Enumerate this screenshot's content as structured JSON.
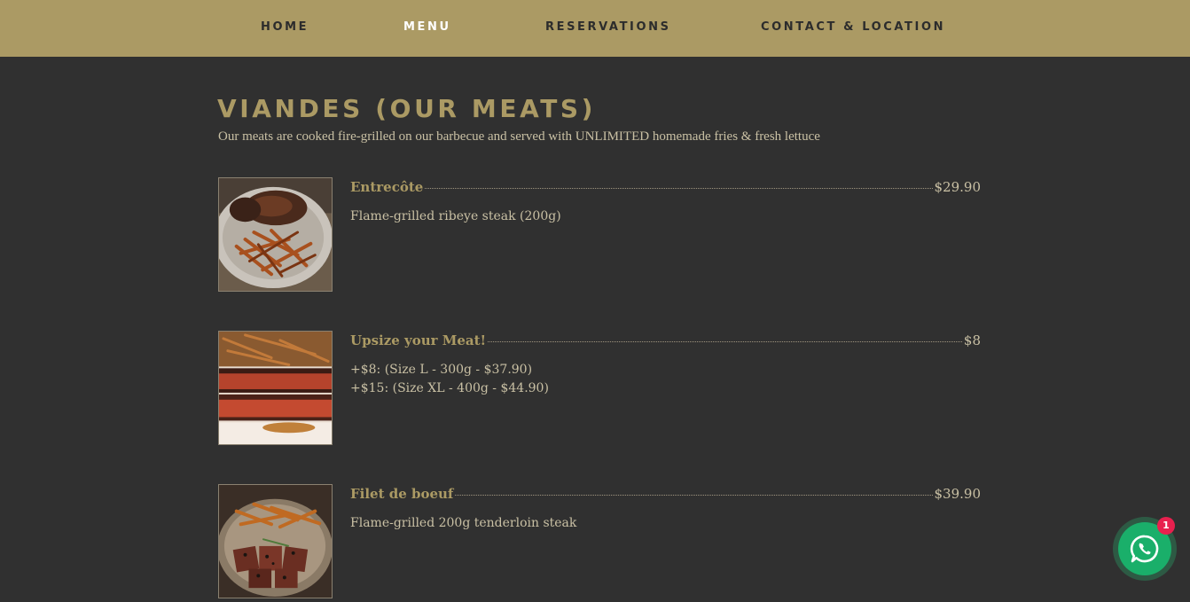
{
  "nav": {
    "items": [
      {
        "label": "HOME",
        "active": false
      },
      {
        "label": "MENU",
        "active": true
      },
      {
        "label": "RESERVATIONS",
        "active": false
      },
      {
        "label": "CONTACT & LOCATION",
        "active": false
      }
    ]
  },
  "section": {
    "title": "VIANDES (OUR MEATS)",
    "subtitle": "Our meats are cooked fire-grilled on our barbecue and served with UNLIMITED homemade fries & fresh lettuce"
  },
  "menu_items": [
    {
      "name": "Entrecôte",
      "price": "$29.90",
      "description": [
        "Flame-grilled ribeye steak (200g)"
      ],
      "image": "steak-and-fries-photo"
    },
    {
      "name": "Upsize your Meat!",
      "price": "$8",
      "description": [
        "+$8: (Size L - 300g - $37.90)",
        "+$15: (Size XL - 400g - $44.90)"
      ],
      "image": "sliced-steak-photo"
    },
    {
      "name": "Filet de boeuf",
      "price": "$39.90",
      "description": [
        "Flame-grilled 200g tenderloin steak"
      ],
      "image": "tenderloin-and-fries-photo"
    }
  ],
  "chat": {
    "icon": "whatsapp-icon",
    "badge": "1"
  },
  "colors": {
    "nav_bg": "#ab9a64",
    "page_bg": "#303030",
    "accent_gold": "#ab9a64",
    "text": "#c9c0a4",
    "whatsapp_green": "#1aaf6a",
    "badge_red": "#e8204e"
  }
}
